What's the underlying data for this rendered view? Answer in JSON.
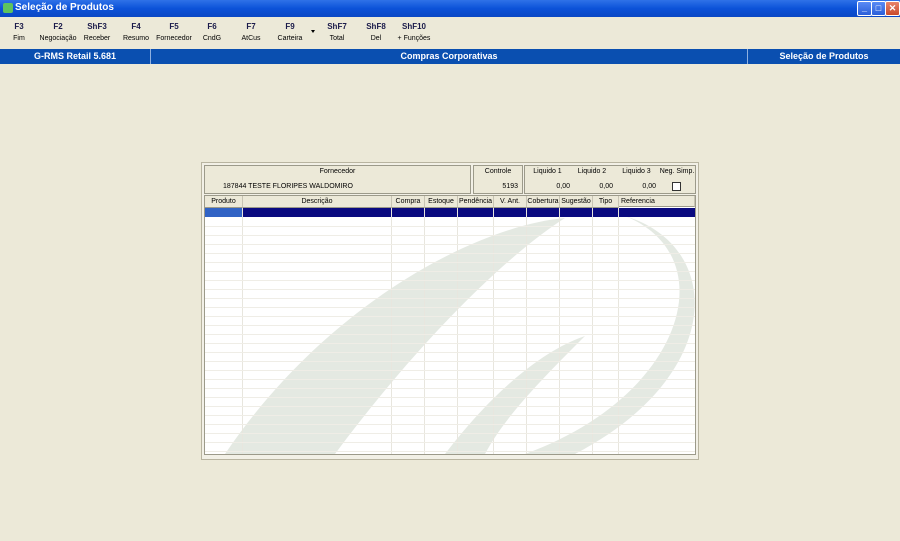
{
  "window": {
    "title": "Seleção de Produtos",
    "min": "_",
    "max": "□",
    "close": "✕"
  },
  "toolbar": [
    {
      "key": "F3",
      "label": "Fim"
    },
    {
      "key": "F2",
      "label": "Negociação"
    },
    {
      "key": "ShF3",
      "label": "Receber"
    },
    {
      "key": "F4",
      "label": "Resumo"
    },
    {
      "key": "F5",
      "label": "Fornecedor"
    },
    {
      "key": "F6",
      "label": "CndG"
    },
    {
      "key": "F7",
      "label": "AtCus"
    },
    {
      "key": "F9",
      "label": "Carteira"
    },
    {
      "key": "ShF7",
      "label": "Total"
    },
    {
      "key": "ShF8",
      "label": "Del"
    },
    {
      "key": "ShF10",
      "label": "+ Funções"
    }
  ],
  "status": {
    "left": "G-RMS Retail 5.681",
    "center": "Compras Corporativas",
    "right": "Seleção de Produtos"
  },
  "header": {
    "fornecedor_label": "Fornecedor",
    "fornecedor_value": "187844  TESTE FLORIPES WALDOMIRO",
    "controle_label": "Controle",
    "controle_value": "5193",
    "liquido1_label": "Liquido 1",
    "liquido1_value": "0,00",
    "liquido2_label": "Liquido 2",
    "liquido2_value": "0,00",
    "liquido3_label": "Liquido 3",
    "liquido3_value": "0,00",
    "negsimp_label": "Neg. Simp."
  },
  "grid": {
    "columns": [
      "Produto",
      "Descrição",
      "Compra",
      "Estoque",
      "Pendência",
      "V. Ant.",
      "Cobertura",
      "Sugestão",
      "Tipo",
      "Referencia"
    ]
  }
}
